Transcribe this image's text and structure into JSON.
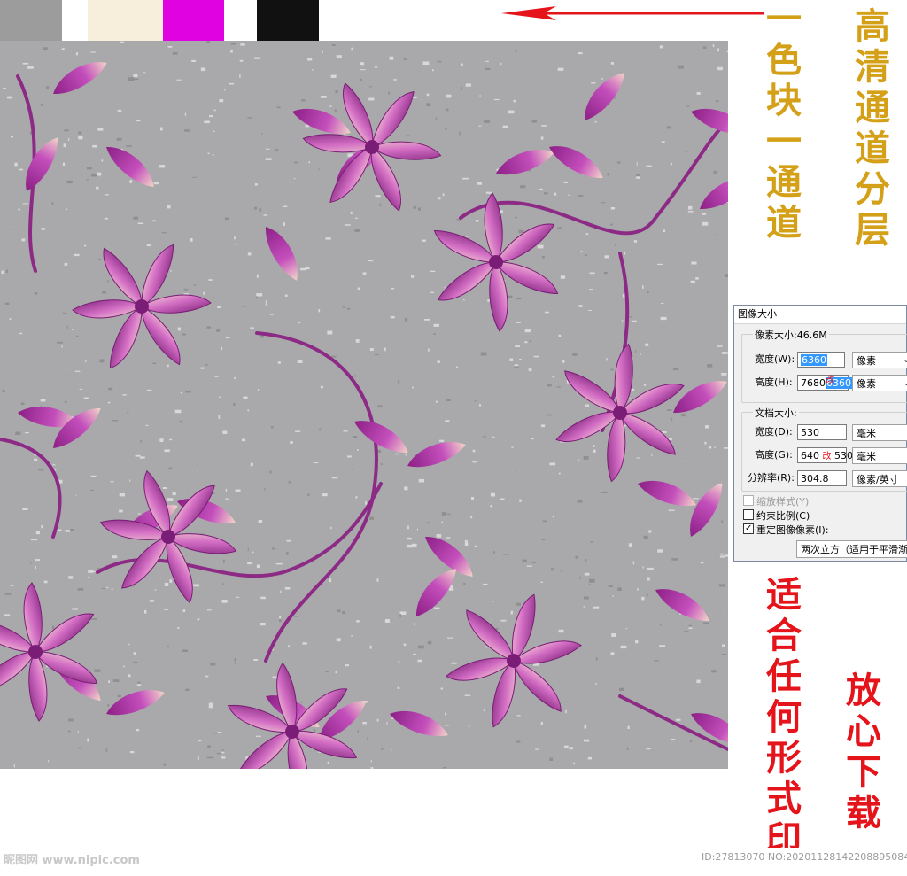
{
  "swatches": [
    {
      "color": "#9c9c9c"
    },
    {
      "color": "#ffffff"
    },
    {
      "color": "#f7efdc"
    },
    {
      "color": "#e002e0"
    },
    {
      "color": "#ffffff"
    },
    {
      "color": "#111111"
    }
  ],
  "colors": {
    "arrow": "#e5141b",
    "gold_text": "#d4a017",
    "red_text": "#e5141b",
    "pattern_bg": "#a9a9ab",
    "petal": "#b23aa5",
    "petal_dark": "#7a1d76",
    "petal_light": "#f7e3cf"
  },
  "promo": {
    "left_vertical": "一色块一通道",
    "right_vertical": "高清通道分层",
    "red_vertical_1": "适合任何形式印",
    "red_vertical_2": "放心下载"
  },
  "dialog": {
    "title": "图像大小",
    "pixel_dimensions_label": "像素大小:46.6M",
    "width_label": "宽度(W):",
    "width_value": "6360",
    "width_unit": "像素",
    "height_label": "高度(H):",
    "height_value_old": "7680",
    "height_value_new": "6360",
    "height_unit": "像素",
    "doc_size_label": "文档大小:",
    "doc_width_label": "宽度(D):",
    "doc_width_value": "530",
    "doc_width_unit": "毫米",
    "doc_height_label": "高度(G):",
    "doc_height_value_old": "640",
    "doc_height_value_new": "530",
    "doc_height_unit": "毫米",
    "resolution_label": "分辨率(R):",
    "resolution_value": "304.8",
    "resolution_unit": "像素/英寸",
    "scale_styles_label": "缩放样式(Y)",
    "constrain_label": "约束比例(C)",
    "resample_label": "重定图像像素(I):",
    "resample_value": "两次立方（适用于平滑渐变",
    "change_mark": "改"
  },
  "footer": {
    "watermark": "昵图网 www.nipic.com",
    "id_text": "ID:27813070 NO:20201128142208895084"
  }
}
